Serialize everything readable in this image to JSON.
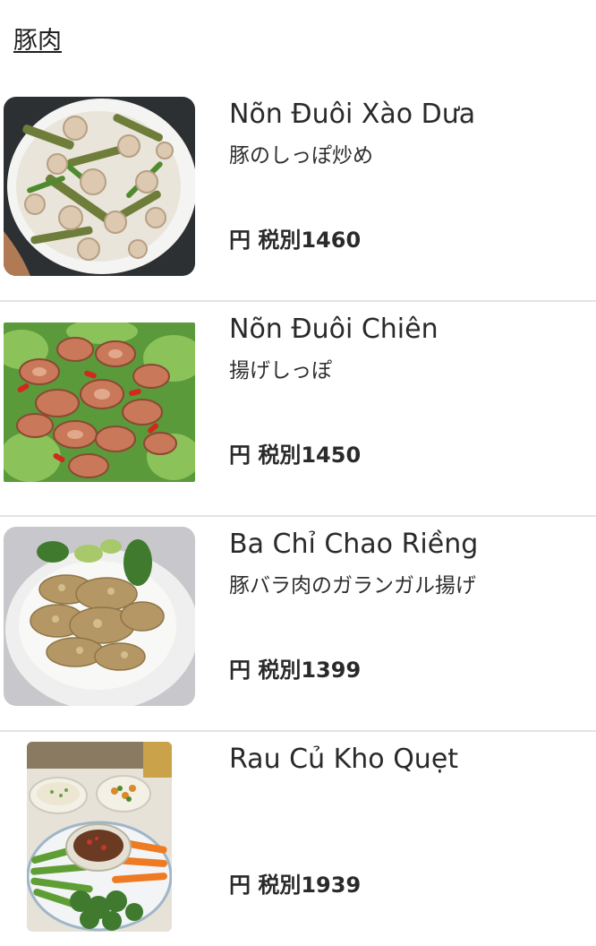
{
  "category": {
    "title": "豚肉"
  },
  "items": [
    {
      "name": "Nõn Đuôi Xào Dưa",
      "subtitle": "豚のしっぽ炒め",
      "price": "円 税別1460",
      "image": "stir-fried-pork-tail-photo"
    },
    {
      "name": "Nõn Đuôi Chiên",
      "subtitle": "揚げしっぽ",
      "price": "円 税別1450",
      "image": "fried-pork-tail-photo"
    },
    {
      "name": "Ba Chỉ Chao Riềng",
      "subtitle": "豚バラ肉のガランガル揚げ",
      "price": "円 税別1399",
      "image": "pork-belly-galangal-photo"
    },
    {
      "name": "Rau Củ Kho Quẹt",
      "subtitle": "",
      "price": "円 税別1939",
      "image": "vegetables-dip-photo"
    }
  ]
}
